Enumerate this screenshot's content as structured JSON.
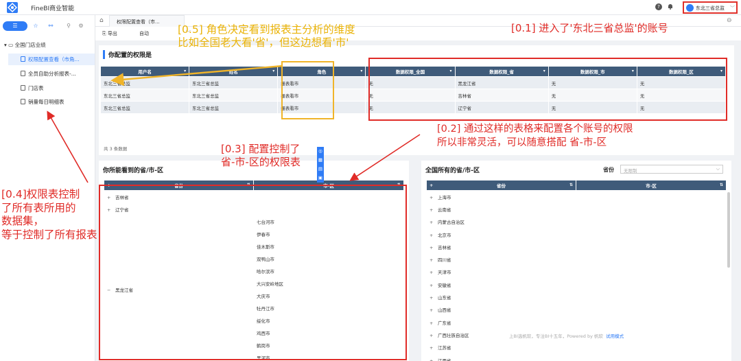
{
  "app": {
    "name": "FineBI商业智能"
  },
  "user": {
    "name": "东北三省总监"
  },
  "sidebar": {
    "folder": "全国门店业绩",
    "items": [
      {
        "label": "权限配置查看（市角..."
      },
      {
        "label": "全员自助分析报表-..."
      },
      {
        "label": "门店表"
      },
      {
        "label": "销量每日明细表"
      }
    ]
  },
  "tab": {
    "label": "权限配置查看（市..."
  },
  "toolbar": {
    "export": "导出",
    "auto": "自动"
  },
  "panel1": {
    "title": "你配置的权限是",
    "headers": [
      "用户名",
      "姓名",
      "角色",
      "数据权限_全国",
      "数据权限_省",
      "数据权限_市",
      "数据权限_区"
    ],
    "rows": [
      [
        "东北三省总监",
        "东北三省总监",
        "报表看市",
        "无",
        "黑龙江省",
        "无",
        "无"
      ],
      [
        "东北三省总监",
        "东北三省总监",
        "报表看市",
        "无",
        "吉林省",
        "无",
        "无"
      ],
      [
        "东北三省总监",
        "东北三省总监",
        "报表看市",
        "无",
        "辽宁省",
        "无",
        "无"
      ]
    ],
    "count": "共 3 条数据"
  },
  "panel2": {
    "title": "你所能看到的省/市-区",
    "headers": [
      "省份",
      "市-区"
    ],
    "provinces": [
      "吉林省",
      "辽宁省",
      "黑龙江省"
    ],
    "cities": [
      "七台河市",
      "伊春市",
      "佳木斯市",
      "双鸭山市",
      "哈尔滨市",
      "大兴安岭地区",
      "大庆市",
      "牡丹江市",
      "绥化市",
      "鸡西市",
      "鹤岗市",
      "黑河市"
    ]
  },
  "panel3": {
    "title": "全国所有的省/市-区",
    "filter_label": "省份",
    "filter_placeholder": "无限制",
    "headers": [
      "省份",
      "市-区"
    ],
    "provinces": [
      "上海市",
      "云南省",
      "内蒙古自治区",
      "北京市",
      "吉林省",
      "四川省",
      "天津市",
      "安徽省",
      "山东省",
      "山西省",
      "广东省",
      "广西壮族自治区",
      "江苏省",
      "江西省"
    ]
  },
  "footer": {
    "text": "上BI选帆软，专注BI十五年，Powered by 帆软",
    "link": "试用模式"
  },
  "annotations": {
    "a01": "[0.1] 进入了'东北三省总监'的账号",
    "a02_1": "[0.2] 通过这样的表格来配置各个账号的权限",
    "a02_2": "所以非常灵活，可以随意搭配 省-市-区",
    "a03_1": "[0.3] 配置控制了",
    "a03_2": "省-市-区的权限表",
    "a04_1": "[0.4]权限表控制",
    "a04_2": "了所有表所用的",
    "a04_3": "数据集，",
    "a04_4": "等于控制了所有报表",
    "a05_1": "[0.5] 角色决定看到报表主分析的维度",
    "a05_2": "比如全国老大看'省'，但这边想看'市'"
  },
  "colors": {
    "accent": "#2f7cf6",
    "header": "#3f5b7a",
    "annotation_red": "#e02b27",
    "annotation_yellow": "#eab308"
  }
}
